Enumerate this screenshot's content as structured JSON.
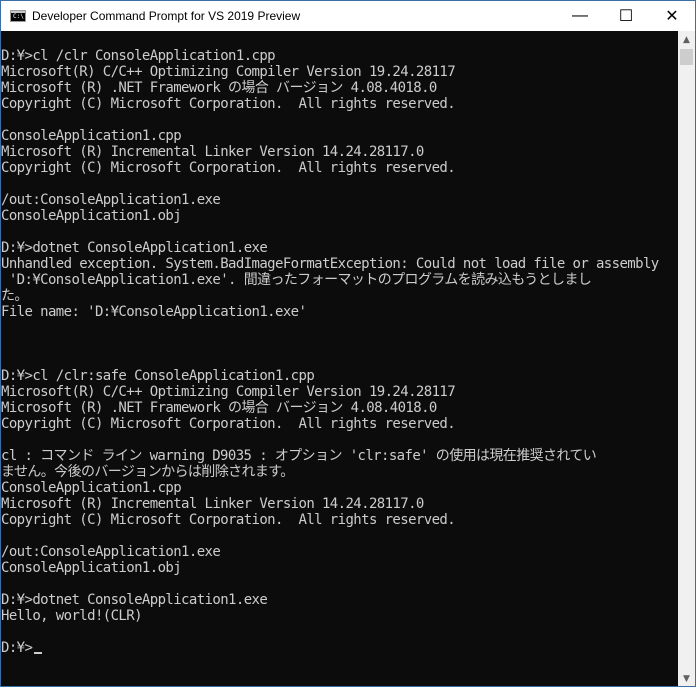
{
  "window": {
    "title": "Developer Command Prompt for VS 2019 Preview",
    "icon_text": "C:\\",
    "minimize_glyph": "—",
    "maximize_glyph": "☐",
    "close_glyph": "✕"
  },
  "scrollbar": {
    "up_glyph": "▲",
    "down_glyph": "▼"
  },
  "console": {
    "lines": [
      "",
      "D:¥>cl /clr ConsoleApplication1.cpp",
      "Microsoft(R) C/C++ Optimizing Compiler Version 19.24.28117",
      "Microsoft (R) .NET Framework の場合 バージョン 4.08.4018.0",
      "Copyright (C) Microsoft Corporation.  All rights reserved.",
      "",
      "ConsoleApplication1.cpp",
      "Microsoft (R) Incremental Linker Version 14.24.28117.0",
      "Copyright (C) Microsoft Corporation.  All rights reserved.",
      "",
      "/out:ConsoleApplication1.exe",
      "ConsoleApplication1.obj",
      "",
      "D:¥>dotnet ConsoleApplication1.exe",
      "Unhandled exception. System.BadImageFormatException: Could not load file or assembly",
      " 'D:¥ConsoleApplication1.exe'. 間違ったフォーマットのプログラムを読み込もうとしまし",
      "た。",
      "File name: 'D:¥ConsoleApplication1.exe'",
      "",
      "",
      "",
      "D:¥>cl /clr:safe ConsoleApplication1.cpp",
      "Microsoft(R) C/C++ Optimizing Compiler Version 19.24.28117",
      "Microsoft (R) .NET Framework の場合 バージョン 4.08.4018.0",
      "Copyright (C) Microsoft Corporation.  All rights reserved.",
      "",
      "cl : コマンド ライン warning D9035 : オプション 'clr:safe' の使用は現在推奨されてい",
      "ません。今後のバージョンからは削除されます。",
      "ConsoleApplication1.cpp",
      "Microsoft (R) Incremental Linker Version 14.24.28117.0",
      "Copyright (C) Microsoft Corporation.  All rights reserved.",
      "",
      "/out:ConsoleApplication1.exe",
      "ConsoleApplication1.obj",
      "",
      "D:¥>dotnet ConsoleApplication1.exe",
      "Hello, world!(CLR)",
      "",
      "D:¥>"
    ]
  }
}
